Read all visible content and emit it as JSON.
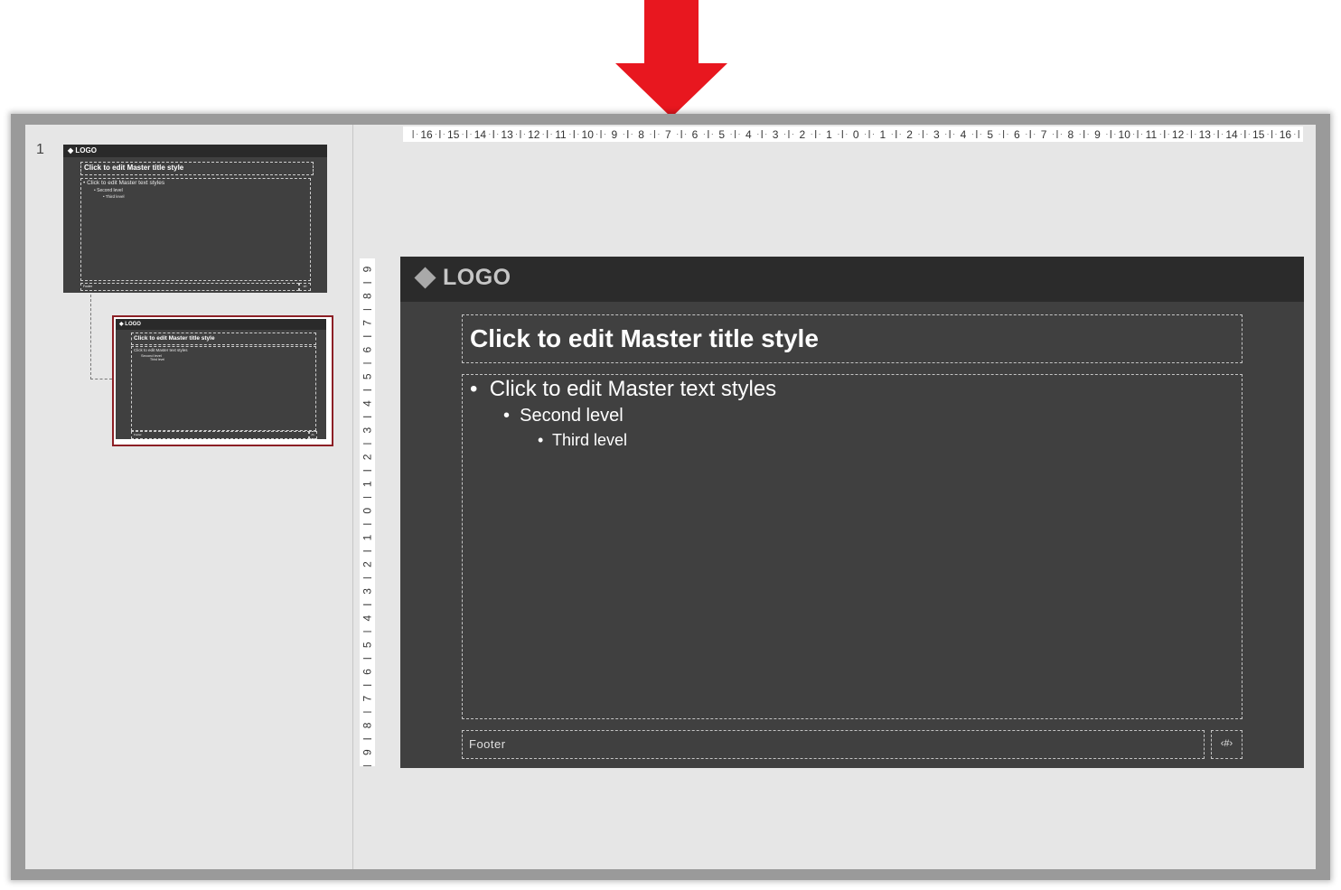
{
  "slide_number": "1",
  "master_slide": {
    "logo": "LOGO",
    "title": "Click to edit Master title style",
    "body_levels": [
      "Click to edit Master text styles",
      "Second level",
      "Third level"
    ],
    "footer": "Footer",
    "slide_number_placeholder": "‹#›"
  },
  "thumbnails": {
    "master": {
      "logo": "LOGO",
      "title": "Click to edit Master title style",
      "body_levels": [
        "Click to edit Master text styles",
        "Second level",
        "Third level"
      ],
      "footer": "Footer",
      "number": "‹#›"
    },
    "layout": {
      "logo": "LOGO",
      "title": "Click to edit Master title style",
      "body_levels": [
        "Click to edit Master text styles",
        "Second level",
        "Third level"
      ],
      "footer": "Footer",
      "number": "‹#›"
    }
  },
  "ruler": {
    "horizontal_labels": [
      "16",
      "15",
      "14",
      "13",
      "12",
      "11",
      "10",
      "9",
      "8",
      "7",
      "6",
      "5",
      "4",
      "3",
      "2",
      "1",
      "0",
      "1",
      "2",
      "3",
      "4",
      "5",
      "6",
      "7",
      "8",
      "9",
      "10",
      "11",
      "12",
      "13",
      "14",
      "15",
      "16"
    ],
    "vertical_labels": [
      "9",
      "8",
      "7",
      "6",
      "5",
      "4",
      "3",
      "2",
      "1",
      "0",
      "1",
      "2",
      "3",
      "4",
      "5",
      "6",
      "7",
      "8",
      "9"
    ]
  },
  "colors": {
    "arrow": "#e8171f",
    "selection_border": "#8c1f25",
    "slide_background": "#404040",
    "slide_header": "#2b2b2b"
  }
}
